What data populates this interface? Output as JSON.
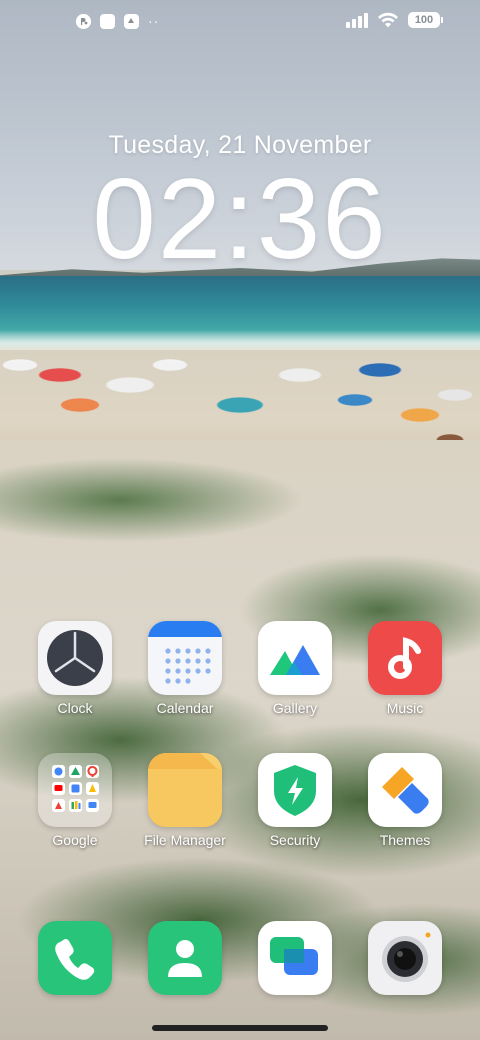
{
  "status_bar": {
    "left_icons": [
      "data-saver-icon",
      "notification-square-icon",
      "upload-icon"
    ],
    "more": "··",
    "battery": "100"
  },
  "lock": {
    "date": "Tuesday, 21 November",
    "time": "02:36"
  },
  "apps": {
    "clock": "Clock",
    "calendar": "Calendar",
    "gallery": "Gallery",
    "music": "Music",
    "google": "Google",
    "file_manager": "File Manager",
    "security": "Security",
    "themes": "Themes"
  },
  "dock": [
    "phone-icon",
    "contacts-icon",
    "messages-icon",
    "camera-icon"
  ],
  "colors": {
    "music": "#ef4a4a",
    "files": "#f3b74a",
    "phone": "#27c47a",
    "contacts": "#27c47a",
    "security": "#1fbf7a",
    "calendar_accent": "#2a7df0"
  }
}
